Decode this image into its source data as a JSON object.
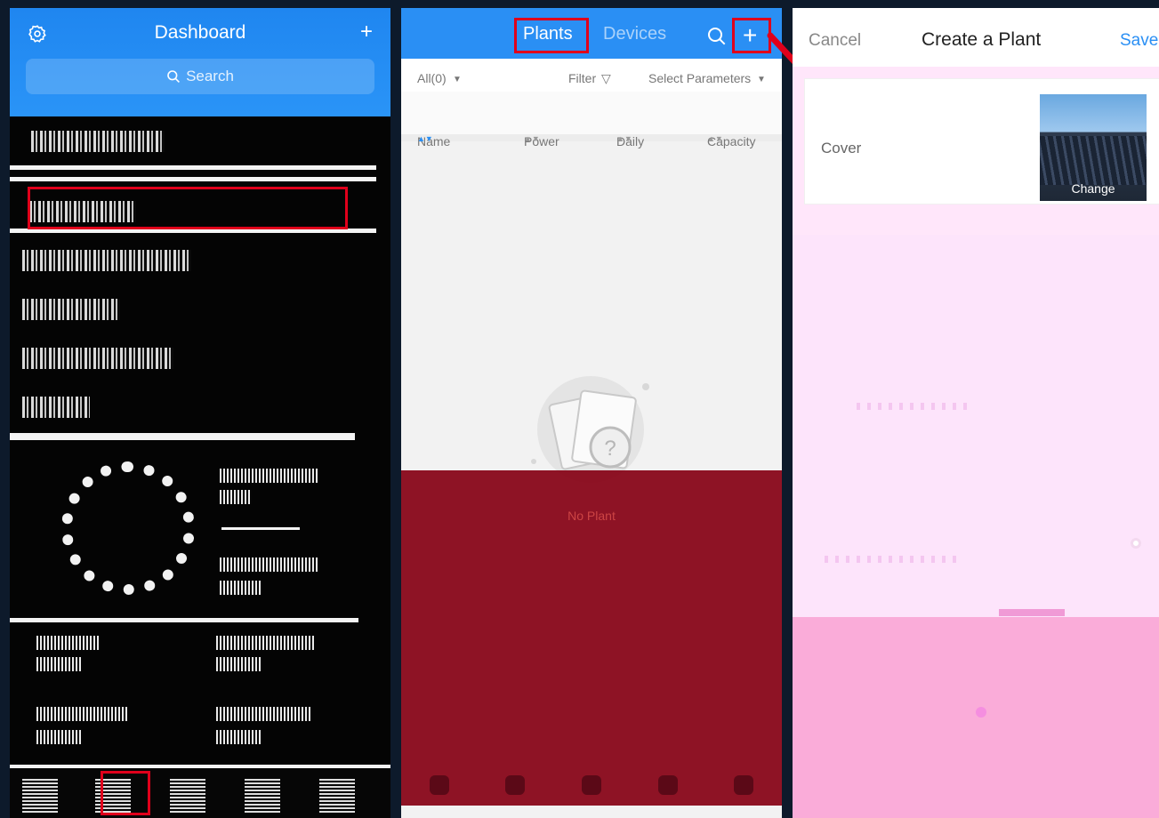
{
  "dashboard": {
    "title": "Dashboard",
    "add_label": "+",
    "search_placeholder": "Search"
  },
  "plants": {
    "tabs": [
      {
        "label": "Plants",
        "active": true
      },
      {
        "label": "Devices",
        "active": false
      }
    ],
    "add_label": "+",
    "filters": {
      "all": "All(0)",
      "filter": "Filter",
      "select_params": "Select Parameters"
    },
    "columns": [
      "Name",
      "Power",
      "Daily",
      "Capacity"
    ],
    "empty_text": "No Plant"
  },
  "create_plant": {
    "cancel": "Cancel",
    "title": "Create a Plant",
    "save": "Save",
    "cover_label": "Cover",
    "change_label": "Change"
  },
  "colors": {
    "accent": "#2a8ff4",
    "highlight": "#e0001b"
  }
}
